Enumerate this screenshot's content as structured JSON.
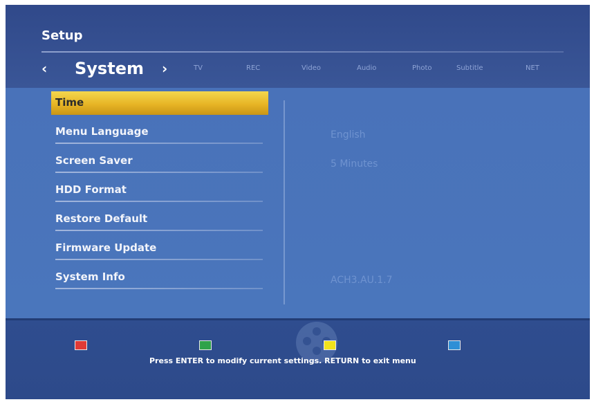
{
  "header": {
    "title": "Setup",
    "prev_label": "‹",
    "current_tab": "System",
    "next_label": "›",
    "tabs": [
      "TV",
      "REC",
      "Video",
      "Audio",
      "Photo",
      "Subtitle",
      "NET"
    ]
  },
  "menu": {
    "items": [
      {
        "label": "Time",
        "value": ""
      },
      {
        "label": "Menu Language",
        "value": "English"
      },
      {
        "label": "Screen Saver",
        "value": "5 Minutes"
      },
      {
        "label": "HDD Format",
        "value": ""
      },
      {
        "label": "Restore Default",
        "value": ""
      },
      {
        "label": "Firmware Update",
        "value": ""
      },
      {
        "label": "System Info",
        "value": "ACH3.AU.1.7"
      }
    ],
    "selected": "Time"
  },
  "footer": {
    "keys": [
      {
        "name": "red",
        "color": "#e03a35"
      },
      {
        "name": "green",
        "color": "#2ea24a"
      },
      {
        "name": "yellow",
        "color": "#f2e31b"
      },
      {
        "name": "blue",
        "color": "#2f8fd6"
      }
    ],
    "hint": "Press ENTER to modify current settings. RETURN to exit menu"
  }
}
